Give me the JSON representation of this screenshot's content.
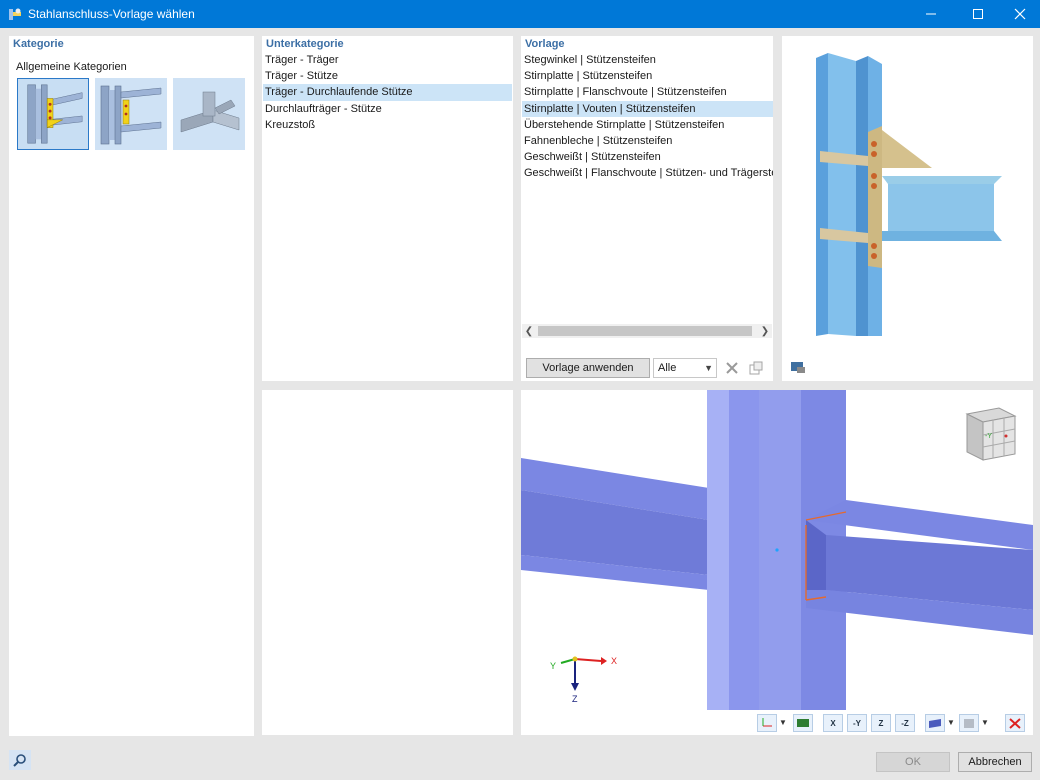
{
  "window": {
    "title": "Stahlanschluss-Vorlage wählen"
  },
  "kategorie": {
    "header": "Kategorie",
    "group_label": "Allgemeine Kategorien",
    "thumbnails": [
      {
        "name": "Träger-Stütze-Anschluss",
        "selected": true
      },
      {
        "name": "Träger-Träger-Anschluss",
        "selected": false
      },
      {
        "name": "Rohrknoten",
        "selected": false
      }
    ]
  },
  "unterkategorie": {
    "header": "Unterkategorie",
    "items": [
      "Träger - Träger",
      "Träger - Stütze",
      "Träger - Durchlaufende Stütze",
      "Durchlaufträger - Stütze",
      "Kreuzstoß"
    ],
    "selected_index": 2
  },
  "vorlage": {
    "header": "Vorlage",
    "items": [
      "Stegwinkel | Stützensteifen",
      "Stirnplatte | Stützensteifen",
      "Stirnplatte | Flanschvoute | Stützensteifen",
      "Stirnplatte | Vouten | Stützensteifen",
      "Überstehende Stirnplatte | Stützensteifen",
      "Fahnenbleche | Stützensteifen",
      "Geschweißt | Stützensteifen",
      "Geschweißt | Flanschvoute | Stützen- und Trägersteifen"
    ],
    "selected_index": 3,
    "apply_button": "Vorlage anwenden",
    "filter_value": "Alle"
  },
  "view3d": {
    "axes": {
      "x": "X",
      "y": "Y",
      "z": "Z"
    },
    "cube_label": "-Y",
    "toolbar": [
      {
        "icon": "axis-system-icon"
      },
      {
        "icon": "view-settings-icon"
      },
      {
        "icon": "view-x-icon",
        "label": "X"
      },
      {
        "icon": "view-minus-y-icon",
        "label": "-Y"
      },
      {
        "icon": "view-z-icon",
        "label": "Z"
      },
      {
        "icon": "view-minus-z-icon",
        "label": "-Z"
      },
      {
        "icon": "display-mode-icon"
      },
      {
        "icon": "render-mode-icon"
      },
      {
        "icon": "reset-view-icon"
      }
    ]
  },
  "footer": {
    "ok": "OK",
    "cancel": "Abbrechen"
  },
  "colors": {
    "titlebar": "#0078d7",
    "selection": "#cce4f7",
    "header": "#3c6fa5",
    "steel": "#7f92e0",
    "plate": "#d9c38a"
  }
}
